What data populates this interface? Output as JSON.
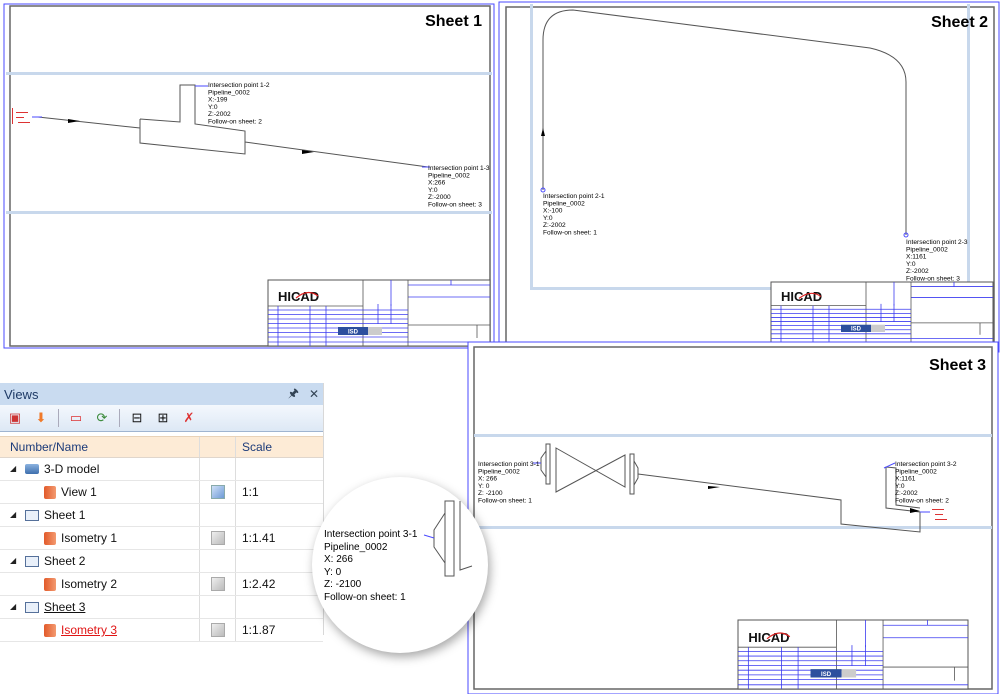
{
  "sheets": [
    {
      "title": "Sheet 1",
      "labels": [
        {
          "lines": [
            "Intersection point 1-2",
            "Pipeline_0002",
            "X:-199",
            "Y:0",
            "Z:-2002",
            "Follow-on sheet: 2"
          ]
        },
        {
          "lines": [
            "Intersection point 1-3",
            "Pipeline_0002",
            "X:266",
            "Y:0",
            "Z:-2000",
            "Follow-on sheet: 3"
          ]
        }
      ]
    },
    {
      "title": "Sheet 2",
      "labels": [
        {
          "lines": [
            "Intersection point 2-1",
            "Pipeline_0002",
            "X:-100",
            "Y:0",
            "Z:-2002",
            "Follow-on sheet: 1"
          ]
        },
        {
          "lines": [
            "Intersection point 2-3",
            "Pipeline_0002",
            "X:1161",
            "Y:0",
            "Z:-2002",
            "Follow-on sheet: 3"
          ]
        }
      ]
    },
    {
      "title": "Sheet 3",
      "labels": [
        {
          "lines": [
            "Intersection point 3-1",
            "Pipeline_0002",
            "X: 266",
            "Y: 0",
            "Z: -2100",
            "Follow-on sheet: 1"
          ]
        },
        {
          "lines": [
            "Intersection point 3-2",
            "Pipeline_0002",
            "X:1161",
            "Y:0",
            "Z:-2002",
            "Follow-on sheet: 2"
          ]
        }
      ]
    }
  ],
  "title_block": {
    "logo": "HiCAD",
    "vendor_logo": "ISD"
  },
  "magnifier": {
    "lines": [
      "Intersection point 3-1",
      "Pipeline_0002",
      "X: 266",
      "Y: 0",
      "Z: -2100",
      "Follow-on sheet: 1"
    ]
  },
  "views_panel": {
    "title": "Views",
    "pin_icon": "pin-icon",
    "close_icon": "close-icon",
    "columns": {
      "name": "Number/Name",
      "icon": "",
      "scale": "Scale"
    },
    "rows": [
      {
        "name": "3-D model",
        "scale": "",
        "level": 0
      },
      {
        "name": "View 1",
        "scale": "1:1",
        "level": 1
      },
      {
        "name": "Sheet 1",
        "scale": "",
        "level": 0
      },
      {
        "name": "Isometry 1",
        "scale": "1:1.41",
        "level": 1
      },
      {
        "name": "Sheet 2",
        "scale": "",
        "level": 0
      },
      {
        "name": "Isometry 2",
        "scale": "1:2.42",
        "level": 1
      },
      {
        "name": "Sheet 3",
        "scale": "",
        "level": 0
      },
      {
        "name": "Isometry 3",
        "scale": "1:1.87",
        "level": 1,
        "active": true
      }
    ]
  },
  "colors": {
    "frame": "#555555",
    "grid": "#3b3bf0",
    "band": "#b8cde6",
    "active": "#e01515"
  }
}
